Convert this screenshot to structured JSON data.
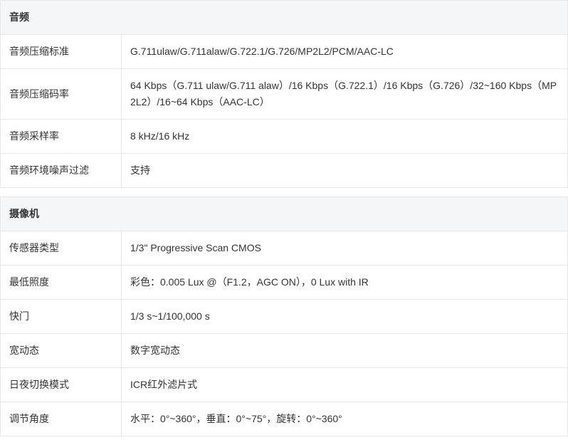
{
  "sections": [
    {
      "title": "音频",
      "rows": [
        {
          "key": "音频压缩标准",
          "value": "G.711ulaw/G.711alaw/G.722.1/G.726/MP2L2/PCM/AAC-LC"
        },
        {
          "key": "音频压缩码率",
          "value": "64 Kbps（G.711 ulaw/G.711 alaw）/16 Kbps（G.722.1）/16 Kbps（G.726）/32~160 Kbps（MP2L2）/16~64 Kbps（AAC-LC）"
        },
        {
          "key": "音频采样率",
          "value": "8 kHz/16 kHz"
        },
        {
          "key": "音频环境噪声过滤",
          "value": "支持"
        }
      ]
    },
    {
      "title": "摄像机",
      "rows": [
        {
          "key": "传感器类型",
          "value": "1/3\" Progressive Scan CMOS"
        },
        {
          "key": "最低照度",
          "value": "彩色：0.005 Lux @（F1.2，AGC ON），0 Lux with IR"
        },
        {
          "key": "快门",
          "value": "1/3 s~1/100,000 s"
        },
        {
          "key": "宽动态",
          "value": "数字宽动态"
        },
        {
          "key": "日夜切换模式",
          "value": "ICR红外滤片式"
        },
        {
          "key": "调节角度",
          "value": "水平：0°~360°，垂直：0°~75°，旋转：0°~360°"
        }
      ]
    }
  ]
}
